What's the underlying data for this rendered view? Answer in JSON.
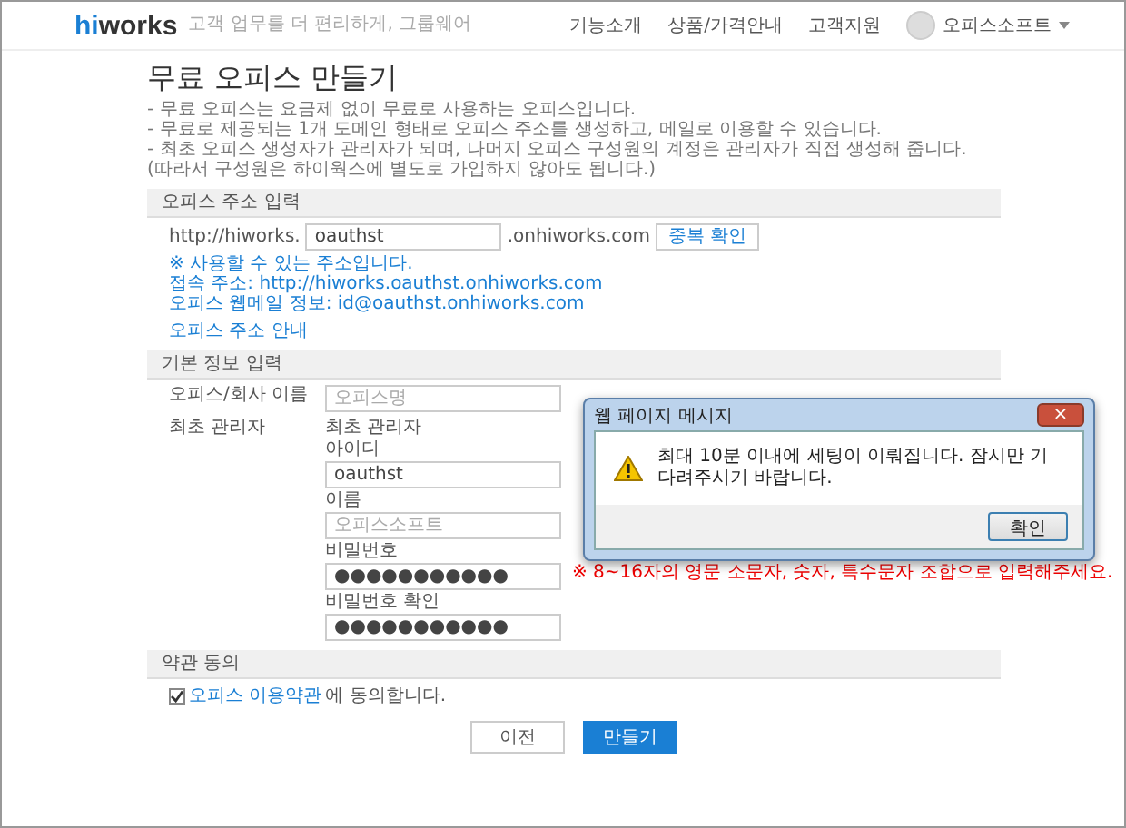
{
  "header": {
    "logo_prefix": "hi",
    "logo_suffix": "works",
    "tagline": "고객 업무를 더 편리하게, 그룹웨어",
    "nav": [
      "기능소개",
      "상품/가격안내",
      "고객지원"
    ],
    "user": "오피스소프트"
  },
  "page": {
    "title": "무료 오피스 만들기",
    "intro": [
      "- 무료 오피스는 요금제 없이 무료로 사용하는 오피스입니다.",
      "- 무료로 제공되는 1개 도메인 형태로 오피스 주소를 생성하고, 메일로 이용할 수 있습니다.",
      "- 최초 오피스 생성자가 관리자가 되며, 나머지 오피스 구성원의 계정은 관리자가 직접 생성해 줍니다.",
      "(따라서 구성원은 하이웍스에 별도로 가입하지 않아도 됩니다.)"
    ]
  },
  "address_section": {
    "heading": "오피스 주소 입력",
    "prefix": "http://hiworks.",
    "value": "oauthst",
    "suffix": ".onhiworks.com",
    "check_button": "중복 확인",
    "notes": [
      "※ 사용할 수 있는 주소입니다.",
      "접속 주소: http://hiworks.oauthst.onhiworks.com",
      "오피스 웹메일 정보: id@oauthst.onhiworks.com"
    ],
    "guide_link": "오피스 주소 안내"
  },
  "basic_section": {
    "heading": "기본 정보 입력",
    "company_label": "오피스/회사 이름",
    "company_placeholder": "오피스명",
    "admin_label": "최초 관리자",
    "admin_sublabel": "최초 관리자",
    "fields": [
      {
        "label": "아이디",
        "value": "oauthst"
      },
      {
        "label": "이름",
        "placeholder": "오피스소프트"
      },
      {
        "label": "비밀번호",
        "value": "●●●●●●●●●●●",
        "hint": "※ 8~16자의 영문 소문자, 숫자, 특수문자 조합으로 입력해주세요."
      },
      {
        "label": "비밀번호 확인",
        "value": "●●●●●●●●●●●"
      }
    ]
  },
  "terms_section": {
    "heading": "약관 동의",
    "checked": true,
    "link": "오피스 이용약관",
    "suffix": "에 동의합니다."
  },
  "buttons": [
    {
      "label": "이전",
      "kind": "secondary"
    },
    {
      "label": "만들기",
      "kind": "primary"
    }
  ],
  "dialog": {
    "title": "웹 페이지 메시지",
    "close": "×",
    "message": "최대 10분 이내에 세팅이 이뤄집니다. 잠시만 기다려주시기 바랍니다.",
    "ok": "확인"
  }
}
